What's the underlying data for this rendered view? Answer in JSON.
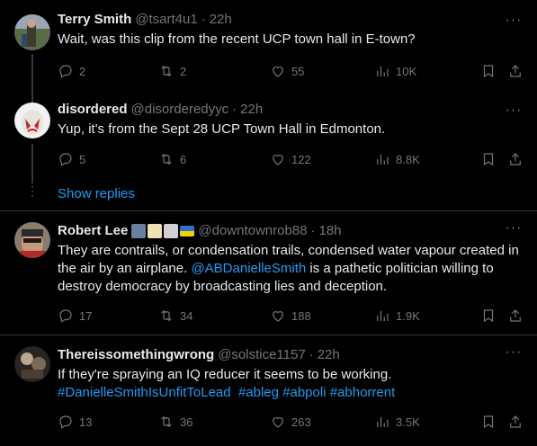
{
  "tweets": [
    {
      "name": "Terry Smith",
      "handle": "@tsart4u1",
      "time": "22h",
      "text": "Wait, was this clip from the recent UCP town hall in E-town?",
      "replies": "2",
      "retweets": "2",
      "likes": "55",
      "views": "10K"
    },
    {
      "name": "disordered",
      "handle": "@disorderedyyc",
      "time": "22h",
      "text": "Yup, it's from the Sept 28 UCP Town Hall in Edmonton.",
      "replies": "5",
      "retweets": "6",
      "likes": "122",
      "views": "8.8K"
    },
    {
      "name": "Robert Lee",
      "handle": "@downtownrob88",
      "time": "18h",
      "text_part1": "They are contrails, or condensation trails, condensed water vapour created in the air by an airplane. ",
      "mention": "@ABDanielleSmith",
      "text_part2": " is a pathetic politician willing to destroy democracy by broadcasting lies and deception.",
      "replies": "17",
      "retweets": "34",
      "likes": "188",
      "views": "1.9K"
    },
    {
      "name": "Thereissomethingwrong",
      "handle": "@solstice1157",
      "time": "22h",
      "text": "If they're spraying an IQ reducer it seems to be working.",
      "hashtags": "#DanielleSmithIsUnfitToLead  #ableg #abpoli #abhorrent",
      "replies": "13",
      "retweets": "36",
      "likes": "263",
      "views": "3.5K"
    }
  ],
  "show_replies": "Show replies",
  "more_icon": "···",
  "colors": {
    "background": "#000000",
    "text": "#e7e9ea",
    "secondary": "#71767b",
    "link": "#1d9bf0",
    "divider": "#2f3336"
  }
}
